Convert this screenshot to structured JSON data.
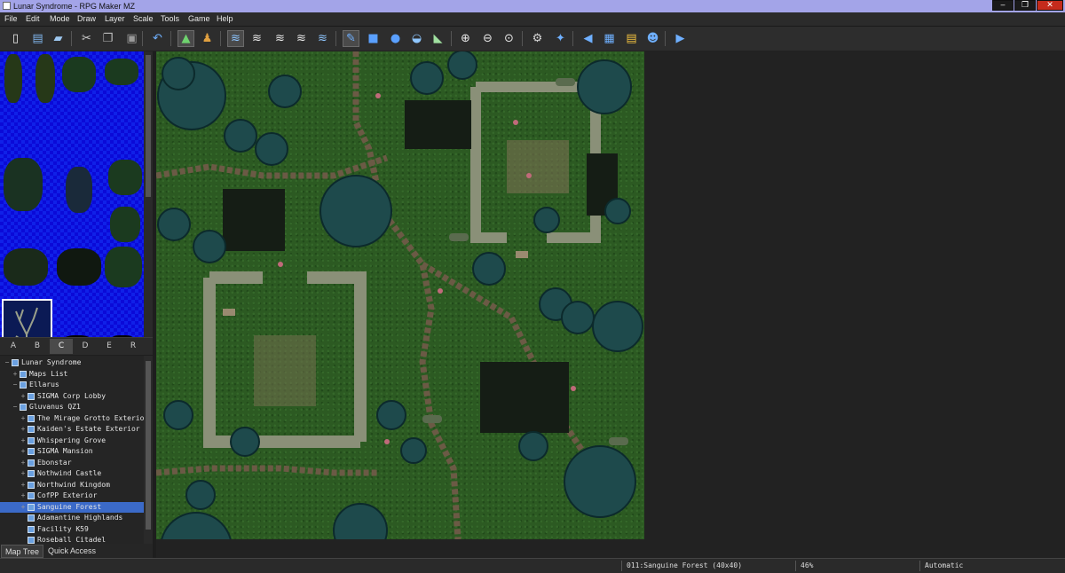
{
  "window": {
    "title": "Lunar Syndrome - RPG Maker MZ",
    "minimize": "‒",
    "maximize": "❐",
    "close": "✕"
  },
  "menu": [
    {
      "label": "File",
      "key": "file"
    },
    {
      "label": "Edit",
      "key": "edit"
    },
    {
      "label": "Mode",
      "key": "mode"
    },
    {
      "label": "Draw",
      "key": "draw"
    },
    {
      "label": "Layer",
      "key": "layer"
    },
    {
      "label": "Scale",
      "key": "scale"
    },
    {
      "label": "Tools",
      "key": "tools"
    },
    {
      "label": "Game",
      "key": "game"
    },
    {
      "label": "Help",
      "key": "help"
    }
  ],
  "toolbar": [
    {
      "name": "new-project-icon",
      "glyph": "▯",
      "color": "#f0f0f0"
    },
    {
      "name": "open-project-icon",
      "glyph": "▤",
      "color": "#7fb4ea"
    },
    {
      "name": "save-project-icon",
      "glyph": "▰",
      "color": "#9ec8f0"
    },
    {
      "name": "cut-icon",
      "glyph": "✂",
      "color": "#cfcfcf"
    },
    {
      "name": "copy-icon",
      "glyph": "❐",
      "color": "#bdbdbd"
    },
    {
      "name": "paste-icon",
      "glyph": "▣",
      "color": "#9a9a9a"
    },
    {
      "name": "undo-icon",
      "glyph": "↶",
      "color": "#6fb0ff"
    },
    {
      "name": "map-mode-icon",
      "glyph": "▲",
      "color": "#6fd36f"
    },
    {
      "name": "event-mode-icon",
      "glyph": "♟",
      "color": "#e0a040"
    },
    {
      "name": "layer-1-icon",
      "glyph": "≋",
      "color": "#8ec6ff"
    },
    {
      "name": "layer-2-icon",
      "glyph": "≋",
      "color": "#e8e8e8"
    },
    {
      "name": "layer-3-icon",
      "glyph": "≋",
      "color": "#e8e8e8"
    },
    {
      "name": "layer-4-icon",
      "glyph": "≋",
      "color": "#e8e8e8"
    },
    {
      "name": "layer-5-icon",
      "glyph": "≋",
      "color": "#8ec6ff"
    },
    {
      "name": "pencil-icon",
      "glyph": "✎",
      "color": "#6fb0ff"
    },
    {
      "name": "rectangle-icon",
      "glyph": "■",
      "color": "#5aa0ff"
    },
    {
      "name": "ellipse-icon",
      "glyph": "●",
      "color": "#5aa0ff"
    },
    {
      "name": "flood-fill-icon",
      "glyph": "◒",
      "color": "#8ec6ff"
    },
    {
      "name": "shadow-pen-icon",
      "glyph": "◣",
      "color": "#a0e0a0"
    },
    {
      "name": "zoom-in-icon",
      "glyph": "⊕",
      "color": "#e8e8e8"
    },
    {
      "name": "zoom-out-icon",
      "glyph": "⊖",
      "color": "#e8e8e8"
    },
    {
      "name": "zoom-actual-icon",
      "glyph": "⊙",
      "color": "#e8e8e8"
    },
    {
      "name": "database-icon",
      "glyph": "⚙",
      "color": "#d8d8d8"
    },
    {
      "name": "plugin-manager-icon",
      "glyph": "✦",
      "color": "#6fb0ff"
    },
    {
      "name": "sound-test-icon",
      "glyph": "◀",
      "color": "#6fb0ff"
    },
    {
      "name": "event-searcher-icon",
      "glyph": "▦",
      "color": "#6fb0ff"
    },
    {
      "name": "resource-manager-icon",
      "glyph": "▤",
      "color": "#f0c040"
    },
    {
      "name": "character-generator-icon",
      "glyph": "☻",
      "color": "#6fb0ff"
    },
    {
      "name": "playtest-icon",
      "glyph": "▶",
      "color": "#6fb0ff"
    }
  ],
  "tileset_tabs": [
    "A",
    "B",
    "C",
    "D",
    "E",
    "R"
  ],
  "tileset_active_tab": "C",
  "map_tree": [
    {
      "label": "Lunar Syndrome",
      "depth": 0,
      "expander": "−",
      "type": "project"
    },
    {
      "label": "Maps List",
      "depth": 1,
      "expander": "+",
      "type": "map"
    },
    {
      "label": "Ellarus",
      "depth": 1,
      "expander": "−",
      "type": "map"
    },
    {
      "label": "SIGMA Corp Lobby",
      "depth": 2,
      "expander": "+",
      "type": "map"
    },
    {
      "label": "Gluvanus QZ1",
      "depth": 1,
      "expander": "−",
      "type": "map"
    },
    {
      "label": "The Mirage Grotto Exterior",
      "depth": 2,
      "expander": "+",
      "type": "map"
    },
    {
      "label": "Kaiden's Estate Exterior",
      "depth": 2,
      "expander": "+",
      "type": "map"
    },
    {
      "label": "Whispering Grove",
      "depth": 2,
      "expander": "+",
      "type": "map"
    },
    {
      "label": "SIGMA Mansion",
      "depth": 2,
      "expander": "+",
      "type": "map"
    },
    {
      "label": "Ebonstar",
      "depth": 2,
      "expander": "+",
      "type": "map"
    },
    {
      "label": "Nothwind Castle",
      "depth": 2,
      "expander": "+",
      "type": "map"
    },
    {
      "label": "Northwind Kingdom",
      "depth": 2,
      "expander": "+",
      "type": "map"
    },
    {
      "label": "CofPP Exterior",
      "depth": 2,
      "expander": "+",
      "type": "map"
    },
    {
      "label": "Sanguine Forest",
      "depth": 2,
      "expander": "+",
      "type": "map",
      "selected": true
    },
    {
      "label": "Adamantine Highlands",
      "depth": 2,
      "expander": "",
      "type": "map"
    },
    {
      "label": "Facility K59",
      "depth": 2,
      "expander": "",
      "type": "map"
    },
    {
      "label": "Roseball Citadel",
      "depth": 2,
      "expander": "",
      "type": "map"
    }
  ],
  "bottom_tabs": {
    "map_tree": "Map Tree",
    "quick_access": "Quick Access"
  },
  "status": {
    "map": "011:Sanguine Forest (40x40)",
    "zoom": "46%",
    "mode": "Automatic"
  },
  "colors": {
    "selection": "#3b6ac8",
    "titlebar": "#a3a4e8",
    "tileset_bg": "#0a0ad8",
    "grass": "#2c5a22"
  }
}
